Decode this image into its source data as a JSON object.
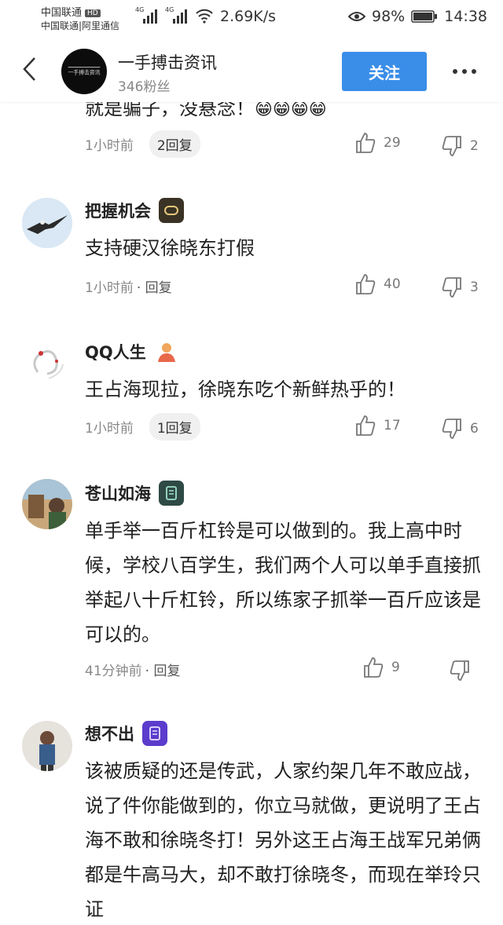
{
  "status": {
    "carrier_top": "中国联通",
    "hd": "HD",
    "carrier_bottom": "中国联通|阿里通信",
    "net1": "4G",
    "net2": "4G",
    "speed": "2.69K/s",
    "battery": "98%",
    "time": "14:38"
  },
  "header": {
    "logo_text": "一手搏击资讯",
    "name": "一手搏击资讯",
    "fans": "346粉丝",
    "follow_label": "关注"
  },
  "comments": [
    {
      "text": "就是骗子，没悬念！",
      "emoji": "😁😁😁😁",
      "time": "1小时前",
      "replies": "2回复",
      "likes": "29",
      "dislikes": "2"
    },
    {
      "user": "把握机会",
      "text": "支持硬汉徐晓东打假",
      "time": "1小时前",
      "reply_label": "· 回复",
      "likes": "40",
      "dislikes": "3"
    },
    {
      "user": "QQ人生",
      "text": "王占海现拉，徐晓东吃个新鲜热乎的！",
      "time": "1小时前",
      "replies": "1回复",
      "likes": "17",
      "dislikes": "6"
    },
    {
      "user": "苍山如海",
      "text": "单手举一百斤杠铃是可以做到的。我上高中时候，学校八百学生，我们两个人可以单手直接抓举起八十斤杠铃，所以练家子抓举一百斤应该是可以的。",
      "time": "41分钟前",
      "reply_label": "· 回复",
      "likes": "9",
      "dislikes": ""
    },
    {
      "user": "想不出",
      "text": "该被质疑的还是传武，人家约架几年不敢应战，说了件你能做到的，你立马就做，更说明了王占海不敢和徐晓冬打！另外这王占海王战军兄弟俩都是牛高马大，却不敢打徐晓冬，而现在举玲只证"
    }
  ]
}
